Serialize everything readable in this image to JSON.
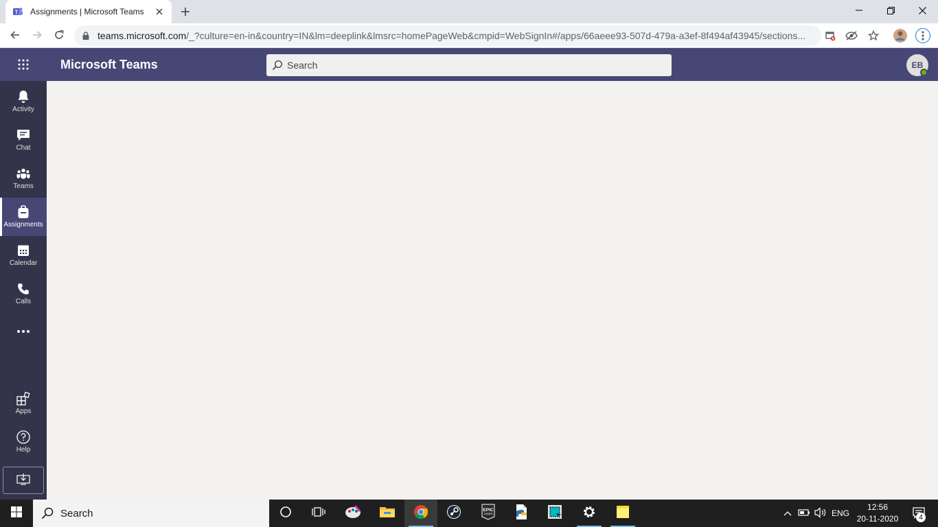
{
  "browser": {
    "tab_title": "Assignments | Microsoft Teams",
    "url_host": "teams.microsoft.com",
    "url_rest": "/_?culture=en-in&country=IN&lm=deeplink&lmsrc=homePageWeb&cmpid=WebSignIn#/apps/66aeee93-507d-479a-a3ef-8f494af43945/sections..."
  },
  "teams": {
    "app_title": "Microsoft Teams",
    "search_placeholder": "Search",
    "avatar_initials": "EB",
    "presence_color": "#6bb700",
    "brand_color": "#464775",
    "rail_color": "#33344a"
  },
  "rail": {
    "items": [
      {
        "label": "Activity",
        "icon": "bell-icon"
      },
      {
        "label": "Chat",
        "icon": "chat-icon"
      },
      {
        "label": "Teams",
        "icon": "teams-icon"
      },
      {
        "label": "Assignments",
        "icon": "backpack-icon",
        "active": true
      },
      {
        "label": "Calendar",
        "icon": "calendar-icon"
      },
      {
        "label": "Calls",
        "icon": "phone-icon"
      },
      {
        "label": "",
        "icon": "more-icon"
      }
    ],
    "bottom": [
      {
        "label": "Apps",
        "icon": "apps-icon"
      },
      {
        "label": "Help",
        "icon": "help-icon"
      }
    ]
  },
  "taskbar": {
    "search_text": "Search",
    "language": "ENG",
    "time": "12:56",
    "date": "20-11-2020",
    "notification_count": "4"
  }
}
